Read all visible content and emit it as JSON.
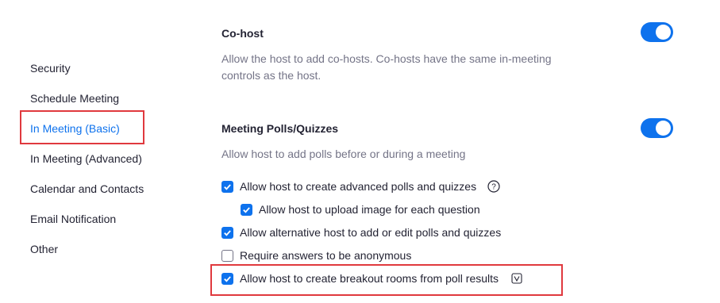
{
  "colors": {
    "accent": "#0e72ed",
    "highlight": "#e0393e",
    "muted": "#747487"
  },
  "sidebar": {
    "items": [
      {
        "label": "Security",
        "active": false
      },
      {
        "label": "Schedule Meeting",
        "active": false
      },
      {
        "label": "In Meeting (Basic)",
        "active": true
      },
      {
        "label": "In Meeting (Advanced)",
        "active": false
      },
      {
        "label": "Calendar and Contacts",
        "active": false
      },
      {
        "label": "Email Notification",
        "active": false
      },
      {
        "label": "Other",
        "active": false
      }
    ]
  },
  "settings": {
    "cohost": {
      "title": "Co-host",
      "description_line1": "Allow the host to add co-hosts. Co-hosts have the same in-meeting",
      "description_line2": "controls as the host.",
      "enabled": true
    },
    "polls": {
      "title": "Meeting Polls/Quizzes",
      "description": "Allow host to add polls before or during a meeting",
      "enabled": true,
      "options": [
        {
          "label": "Allow host to create advanced polls and quizzes",
          "checked": true,
          "icon": "help-icon"
        },
        {
          "label": "Allow host to upload image for each question",
          "checked": true
        },
        {
          "label": "Allow alternative host to add or edit polls and quizzes",
          "checked": true
        },
        {
          "label": "Require answers to be anonymous",
          "checked": false
        },
        {
          "label": "Allow host to create breakout rooms from poll results",
          "checked": true,
          "icon": "version-badge-icon"
        }
      ]
    }
  }
}
